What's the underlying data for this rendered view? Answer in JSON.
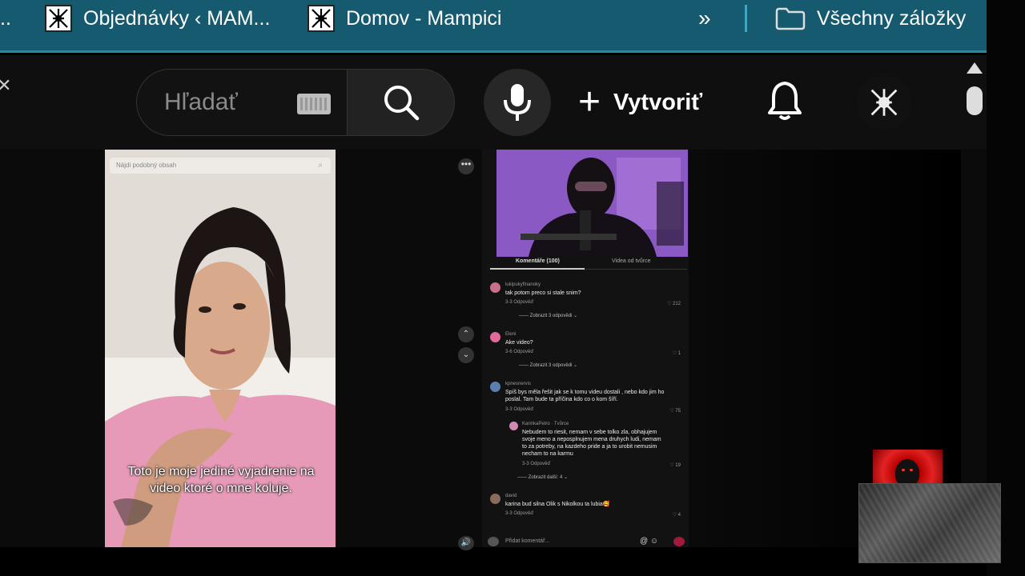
{
  "bookmarks": {
    "items": [
      {
        "label": "Objednávky ‹ MAM..."
      },
      {
        "label": "Domov - Mampici"
      }
    ],
    "truncated_prefix": "..",
    "more_symbol": "»",
    "all_bookmarks_label": "Všechny záložky"
  },
  "youtube": {
    "search_placeholder": "Hľadať",
    "create_label": "Vytvoriť"
  },
  "left_video": {
    "search_placeholder": "Nájdi podobný obsah",
    "subtitle": "Toto je moje jediné vyjadrenie na video ktoré o mne koluje."
  },
  "panel": {
    "tabs": [
      {
        "label": "Komentáře (100)"
      },
      {
        "label": "Videa od tvůrce"
      }
    ],
    "comments": [
      {
        "user": "lukipukyfinanoky",
        "text": "tak potom preco si stale snim?",
        "meta": "3-3 Odpověď",
        "likes": "♡ 212",
        "replies": "—— Zobrazit 3 odpovědi ⌄",
        "avatar_color": "#c86f8a"
      },
      {
        "user": "Eleni",
        "text": "Ake video?",
        "meta": "3-6 Odpověď",
        "likes": "♡ 1",
        "replies": "—— Zobrazit 3 odpovědi ⌄",
        "avatar_color": "#e06a9a"
      },
      {
        "user": "kpnesnervis",
        "text": "Spíš bys měla řešit jak se k tomu videu dostali , nebo kdo jim ho poslal. Tam bude ta příčina kdo co o kom šíří.",
        "meta": "3-3 Odpověď",
        "likes": "♡ 75",
        "replies": "",
        "avatar_color": "#5a7fb0"
      },
      {
        "user": "KarinkaPetro · Tvůrce",
        "text": "Nebudem to riesit, nemam v sebe tolko zla, obhajujem svoje meno a neposplnujem mena druhych ludi, nemam to za potreby, na kazdeho pride a ja to urobit nemusim necham to na karmu",
        "meta": "3-3 Odpověď",
        "likes": "♡ 19",
        "replies": "—— Zobrazit další: 4 ⌄",
        "avatar_color": "#d08ab0"
      },
      {
        "user": "david",
        "text": "karina bud silna Olik s Nikolkou ta lubia🥰",
        "meta": "3-3 Odpověď",
        "likes": "♡ 4",
        "replies": "",
        "avatar_color": "#8a6a5a"
      }
    ],
    "add_comment_placeholder": "Přidat komentář...",
    "add_comment_icons": "@ ☺"
  },
  "controls": {
    "more": "•••",
    "up": "⌃",
    "down": "⌄",
    "volume": "🔊"
  }
}
